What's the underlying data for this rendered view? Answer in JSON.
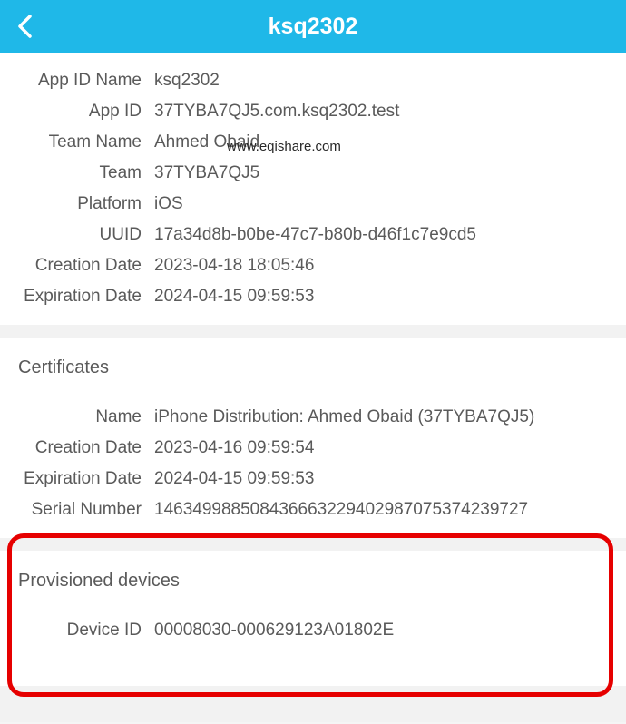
{
  "header": {
    "title": "ksq2302"
  },
  "profile": {
    "appIdName": {
      "label": "App ID Name",
      "value": "ksq2302"
    },
    "appId": {
      "label": "App ID",
      "value": "37TYBA7QJ5.com.ksq2302.test"
    },
    "teamName": {
      "label": "Team Name",
      "value": "Ahmed Obaid"
    },
    "team": {
      "label": "Team",
      "value": "37TYBA7QJ5"
    },
    "platform": {
      "label": "Platform",
      "value": "iOS"
    },
    "uuid": {
      "label": "UUID",
      "value": "17a34d8b-b0be-47c7-b80b-d46f1c7e9cd5"
    },
    "creationDate": {
      "label": "Creation Date",
      "value": "2023-04-18 18:05:46"
    },
    "expirationDate": {
      "label": "Expiration Date",
      "value": "2024-04-15 09:59:53"
    }
  },
  "certificates": {
    "title": "Certificates",
    "name": {
      "label": "Name",
      "value": "iPhone Distribution: Ahmed Obaid (37TYBA7QJ5)"
    },
    "creationDate": {
      "label": "Creation Date",
      "value": "2023-04-16 09:59:54"
    },
    "expirationDate": {
      "label": "Expiration Date",
      "value": "2024-04-15 09:59:53"
    },
    "serialNumber": {
      "label": "Serial Number",
      "value": "146349988508436663229402987075374239727"
    }
  },
  "provisionedDevices": {
    "title": "Provisioned devices",
    "deviceId": {
      "label": "Device ID",
      "value": "00008030-000629123A01802E"
    }
  },
  "watermark": "www.eqishare.com"
}
